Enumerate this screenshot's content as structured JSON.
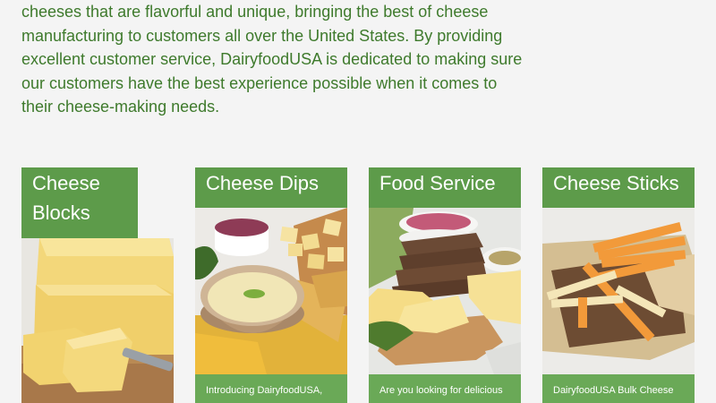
{
  "intro": {
    "text": "cheeses that are flavorful and unique, bringing the best of cheese manufacturing to customers all over the United States. By providing excellent customer service, DairyfoodUSA is dedicated to making sure our customers have the best experience possible when it comes to their cheese-making needs."
  },
  "cards": [
    {
      "title": "Cheese Blocks",
      "teaser": ""
    },
    {
      "title": "Cheese Dips",
      "teaser": "Introducing DairyfoodUSA,"
    },
    {
      "title": "Food Service",
      "teaser": "Are you looking for delicious"
    },
    {
      "title": "Cheese Sticks",
      "teaser": "DairyfoodUSA Bulk Cheese"
    }
  ],
  "colors": {
    "text_green": "#3e7a2c",
    "header_green": "#5d9b4a",
    "footer_green": "#6aa957",
    "background": "#f4f4f4"
  }
}
